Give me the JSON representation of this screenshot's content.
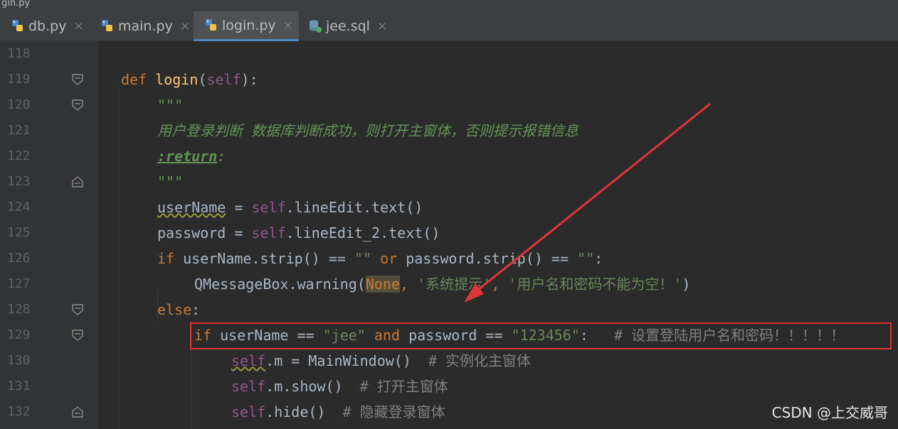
{
  "window": {
    "title_fragment": "gin.py"
  },
  "tabs": [
    {
      "label": "db.py",
      "icon": "python-file-icon",
      "active": false
    },
    {
      "label": "main.py",
      "icon": "python-file-icon",
      "active": false
    },
    {
      "label": "login.py",
      "icon": "python-file-icon",
      "active": true
    },
    {
      "label": "jee.sql",
      "icon": "sql-file-icon",
      "active": false
    }
  ],
  "tab_close_glyph": "×",
  "line_numbers": [
    "118",
    "119",
    "120",
    "121",
    "122",
    "123",
    "124",
    "125",
    "126",
    "127",
    "128",
    "129",
    "130",
    "131",
    "132"
  ],
  "code": {
    "l119": {
      "kw": "def ",
      "fn": "login",
      "p1": "(",
      "self": "self",
      "p2": "):"
    },
    "l120": "\"\"\"",
    "l121": "用户登录判断 数据库判断成功，则打开主窗体，否则提示报错信息",
    "l122": {
      "tag": ":return",
      "colon": ":"
    },
    "l123": "\"\"\"",
    "l124": {
      "var": "userName",
      "eq": " = ",
      "self": "self",
      "rest": ".lineEdit.text()"
    },
    "l125": {
      "var": "password = ",
      "self": "self",
      "rest": ".lineEdit_2.text()"
    },
    "l126": {
      "kw": "if ",
      "a": "userName.strip() == ",
      "s1": "\"\"",
      "or": " or ",
      "b": "password.strip() == ",
      "s2": "\"\"",
      "end": ":"
    },
    "l127": {
      "a": "QMessageBox.warning(",
      "none": "None",
      "comma1": ", ",
      "s1": "'系统提示'",
      "comma2": ", ",
      "s2": "'用户名和密码不能为空！'",
      "end": ")"
    },
    "l128": {
      "kw": "else",
      "end": ":"
    },
    "l129": {
      "kw": "if ",
      "a": "userName == ",
      "s1": "\"jee\"",
      "and": " and ",
      "b": "password == ",
      "s2": "\"123456\"",
      "end": ":",
      "cmt": "   # 设置登陆用户名和密码！！！！！"
    },
    "l130": {
      "self": "self",
      "rest": ".m = MainWindow()",
      "cmt": "  # 实例化主窗体"
    },
    "l131": {
      "self": "self",
      "rest": ".m.show()",
      "cmt": "  # 打开主窗体"
    },
    "l132": {
      "self": "self",
      "rest": ".hide()",
      "cmt": "  # 隐藏登录窗体"
    }
  },
  "watermark": "CSDN @上交威哥",
  "colors": {
    "background": "#2b2b2b",
    "keyword": "#cc7832",
    "function": "#ffc66d",
    "self": "#94558d",
    "string": "#6a8759",
    "annotation": "#e03535",
    "active_tab_underline": "#4a88c7"
  }
}
